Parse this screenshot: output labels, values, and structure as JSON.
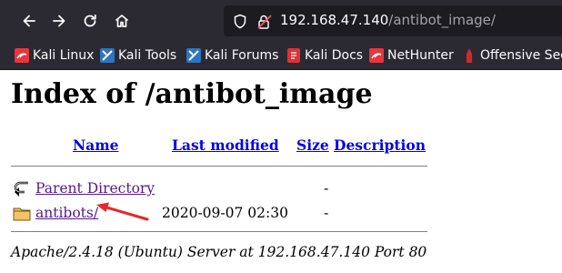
{
  "browser": {
    "url_host": "192.168.47.140",
    "url_path": "/antibot_image/",
    "bookmarks": [
      {
        "label": "Kali Linux",
        "icon": "kali-icon"
      },
      {
        "label": "Kali Tools",
        "icon": "kali-tools-icon"
      },
      {
        "label": "Kali Forums",
        "icon": "kali-forums-icon"
      },
      {
        "label": "Kali Docs",
        "icon": "kali-docs-icon"
      },
      {
        "label": "NetHunter",
        "icon": "nethunter-icon"
      },
      {
        "label": "Offensive Secu",
        "icon": "offsec-icon"
      }
    ]
  },
  "page": {
    "title": "Index of /antibot_image",
    "columns": {
      "name": "Name",
      "modified": "Last modified",
      "size": "Size",
      "description": "Description"
    },
    "rows": [
      {
        "name": "Parent Directory",
        "modified": "",
        "size": "-",
        "description": "",
        "icon": "back-arrow-icon"
      },
      {
        "name": "antibots/",
        "modified": "2020-09-07 02:30",
        "size": "-",
        "description": "",
        "icon": "folder-icon"
      }
    ],
    "footer": "Apache/2.4.18 (Ubuntu) Server at 192.168.47.140 Port 80"
  },
  "colors": {
    "toolbar": "#2b2a33",
    "urlbar": "#1c1b22",
    "link": "#0000ee",
    "visited_link": "#551a8b",
    "annotation_arrow": "#e8262b"
  }
}
